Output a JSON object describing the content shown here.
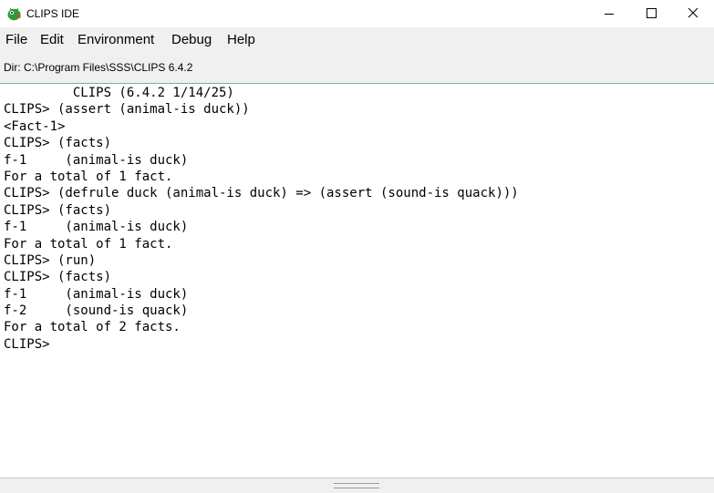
{
  "window": {
    "title": "CLIPS IDE",
    "app_icon": "clips-bug-icon",
    "controls": {
      "minimize_icon": "minimize-icon",
      "maximize_icon": "maximize-icon",
      "close_icon": "close-icon"
    }
  },
  "menu": {
    "items": [
      {
        "label": "File"
      },
      {
        "label": "Edit"
      },
      {
        "label": "Environment"
      },
      {
        "label": "Debug"
      },
      {
        "label": "Help"
      }
    ]
  },
  "dir_bar": {
    "text": "Dir: C:\\Program Files\\SSS\\CLIPS 6.4.2"
  },
  "console": {
    "lines": [
      "         CLIPS (6.4.2 1/14/25)",
      "CLIPS> (assert (animal-is duck))",
      "<Fact-1>",
      "CLIPS> (facts)",
      "f-1     (animal-is duck)",
      "For a total of 1 fact.",
      "CLIPS> (defrule duck (animal-is duck) => (assert (sound-is quack)))",
      "CLIPS> (facts)",
      "f-1     (animal-is duck)",
      "For a total of 1 fact.",
      "CLIPS> (run)",
      "CLIPS> (facts)",
      "f-1     (animal-is duck)",
      "f-2     (sound-is quack)",
      "For a total of 2 facts.",
      "CLIPS> "
    ]
  },
  "colors": {
    "chrome_bg": "#f0f0f0",
    "console_bg": "#ffffff",
    "accent_line": "#66b8ae",
    "icon_green": "#2e9b3a",
    "icon_red": "#d93a2b"
  }
}
